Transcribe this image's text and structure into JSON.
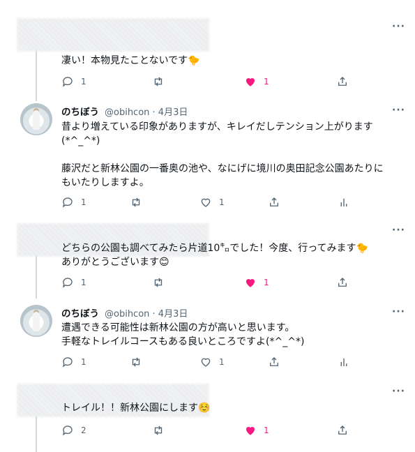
{
  "colors": {
    "like": "#f91880",
    "muted": "#536471",
    "line": "#cfd9de",
    "text": "#0f1419"
  },
  "more_label": "···",
  "tweets": [
    {
      "type": "reply",
      "text": "凄い！本物見たことないです🐤",
      "actions": {
        "replies": "1",
        "likes": "1",
        "liked": true
      }
    },
    {
      "type": "author",
      "name": "のちぼう",
      "handle_time": "@obihcon · 4月3日",
      "text": "昔より増えている印象がありますが、キレイだしテンション上がります\n(*^_^*)\n\n藤沢だと新林公園の一番奥の池や、なにげに境川の奥田記念公園あたりに\nもいたりしますよ。",
      "actions": {
        "replies": "1",
        "likes": "1",
        "liked": false
      }
    },
    {
      "type": "reply",
      "text": "どちらの公園も調べてみたら片道10㌔でした！今度、行ってみます🐤\nありがとうございます😊",
      "actions": {
        "replies": "1",
        "likes": "1",
        "liked": true
      }
    },
    {
      "type": "author",
      "name": "のちぼう",
      "handle_time": "@obihcon · 4月3日",
      "text": "遭遇できる可能性は新林公園の方が高いと思います。\n手軽なトレイルコースもある良いところですよ(*^_^*)",
      "actions": {
        "replies": "1",
        "likes": "1",
        "liked": false
      }
    },
    {
      "type": "reply",
      "text": "トレイル！！新林公園にします☺️",
      "actions": {
        "replies": "2",
        "likes": "1",
        "liked": true
      }
    }
  ]
}
